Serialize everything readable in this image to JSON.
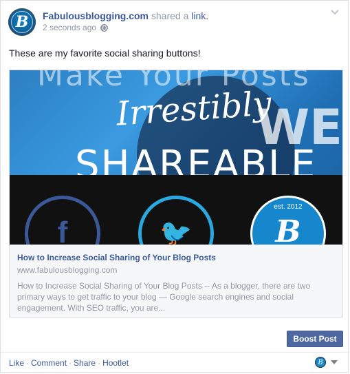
{
  "post": {
    "author": "Fabulousblogging.com",
    "shared_text": "shared a",
    "shared_link": "link.",
    "timestamp": "2 seconds ago",
    "message": "These are my favorite social sharing buttons!"
  },
  "preview": {
    "image_text": {
      "headline": "Make Your Posts",
      "script": "Irrestibly",
      "shareable": "SHAREABLE",
      "we": "WE",
      "est": "est. 2012",
      "fb_letter": "f",
      "tw_glyph": "🐦",
      "logo_letter": "B"
    },
    "title": "How to Increase Social Sharing of Your Blog Posts",
    "domain": "www.fabulousblogging.com",
    "description": "How to Increase Social Sharing of Your Blog Posts -- As a blogger, there are two primary ways to get traffic to your blog — Google search engines and social engagement. With SEO traffic, you are..."
  },
  "boost_label": "Boost Post",
  "actions": {
    "like": "Like",
    "comment": "Comment",
    "share": "Share",
    "hootlet": "Hootlet",
    "separator": "·"
  },
  "colors": {
    "link_blue": "#3b5998",
    "meta_gray": "#9197a3",
    "boost_bg": "#4e69a2"
  }
}
